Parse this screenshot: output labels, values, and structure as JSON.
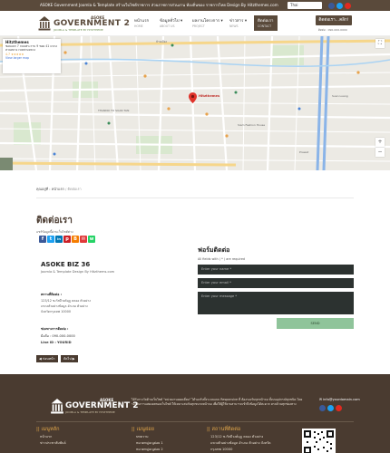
{
  "topbar": {
    "text": "ASOKE Government Joomla & Template  สร้างเว็บไซต์ราชการ ส่วนราชการส่วนงาน ท้องถิ่นของ ราชการไทย Design By Hitzthemes.com",
    "language": "Thai"
  },
  "logo": {
    "top": "ASOKE",
    "main": "GOVERNMENT 2",
    "sub": "JOOMLA & TEMPLATE BY HITZTHEME"
  },
  "nav": [
    {
      "label": "หน้าแรก",
      "sub": "HOME"
    },
    {
      "label": "ข้อมูลทั่วไป ▾",
      "sub": "ABOUT US"
    },
    {
      "label": "ผลงานโครงการ ▾",
      "sub": "PROJECT"
    },
    {
      "label": "ข่าวสาร ▾",
      "sub": "NEWS"
    },
    {
      "label": "ติดต่อเรา",
      "sub": "CONTACT"
    }
  ],
  "header_cta": {
    "label": "ติดต่อเรา...คลิก!",
    "phone": "ติดต่อ : 090-000-0000"
  },
  "map": {
    "place_name": "Hitzthemes",
    "place_address": "ซอยแยก 7 ถนนพระราม 9 ซอย 41 แขวงสวนหลวง เขตสวนหลวง",
    "rating": "4.7 ★★★★★",
    "view_link": "View larger map",
    "labels": [
      "บ้าน หนองบอน",
      "บ้านเมือง",
      "THANNO TO SUAN TAN",
      "Hitzthemes",
      "Siam Fashion House",
      "Suan Luang",
      "Prawet"
    ]
  },
  "breadcrumb": {
    "label": "คุณอยู่ที่ :",
    "home": "หน้าแรก",
    "sep": "/",
    "current": "ติดต่อเรา"
  },
  "page": {
    "title": "ติดต่อเรา",
    "share_label": "แชร์ข้อมูลนี้ผ่านเว็บไซต์ต่าง"
  },
  "share_buttons": [
    {
      "name": "facebook",
      "glyph": "f",
      "color": "#3b5998"
    },
    {
      "name": "twitter",
      "glyph": "t",
      "color": "#1da1f2"
    },
    {
      "name": "linkedin",
      "glyph": "in",
      "color": "#0077b5"
    },
    {
      "name": "pinterest",
      "glyph": "p",
      "color": "#cb2027"
    },
    {
      "name": "blogger",
      "glyph": "B",
      "color": "#f57d00"
    },
    {
      "name": "email",
      "glyph": "✉",
      "color": "#e03a3a"
    },
    {
      "name": "whatsapp",
      "glyph": "w",
      "color": "#25d366"
    }
  ],
  "company": {
    "name": "ASOKE BIZ 36",
    "sub": "Joomla & Template Design By Hitzthems.com",
    "address_heading": "สถานที่ติดต่อ :",
    "address_lines": [
      "123/12 ซ.กัสมีวงค์มุฎ คลอง ตัวอย่าง",
      "แขวงตัวอย่างข้อมูล อำเภอ ตัวอย่าง",
      "จังหวัดกรุงเทพ 10000"
    ],
    "contact_heading": "ช่องทางการติดต่อ :",
    "phone": "มือถือ : 090-000-0000",
    "line": "Line ID : YOURID"
  },
  "form": {
    "title": "ฟอร์มติดต่อ",
    "note": "All fields with ( * ) are required",
    "name_placeholder": "Enter your name *",
    "email_placeholder": "Enter your email *",
    "message_placeholder": "Enter your message *",
    "send_label": "SEND"
  },
  "pager": {
    "prev": "◀ ก่อนหน้า",
    "next": "ถัดไป ▶"
  },
  "footer": {
    "logo_top": "ASOKE",
    "logo_main": "GOVERNMENT 2",
    "logo_sub": "JOOMLA & TEMPLATE BY HITZTHEME",
    "description": "ได้รับรางวัลด้านเว็บไซต์ \"หน่วยงานยอดเยี่ยม\" ได้รองรับทั้งระบบแบบ Responsive ที่ ต้องรองรับทุกหน้าจอ ทั้งบนอุปกรณ์ทุกชนิด โดยรองรับการแสดงผลของเว็บไซต์ ให้เหมาะสมกับทุกขนาดหน้าจอ เพื่อให้ผู้ใช้งานสามารถเข้าถึงข้อมูลได้สะดวก ครบถ้วนทุกช่องทาง",
    "email": "✉ info@yourdomain.com",
    "col1_heading": "|| เมนูหลัก",
    "col1_items": [
      "หน้าแรก",
      "ข่าวประชาสัมพันธ์"
    ],
    "col2_heading": "|| เมนูย่อย",
    "col2_items": [
      "บทความ",
      "หมวดหมู่เมนูย่อย 1",
      "หมวดหมู่เมนูย่อย 2"
    ],
    "col3_heading": "|| สถานที่ติดต่อ",
    "col3_items": [
      "123/12 ซ.กัสมีวงค์มุฎ คลอง ตัวอย่าง",
      "แขวงตัวอย่างข้อมูล อำเภอ ตัวอย่าง จังหวัด",
      "กรุงเทพ 10000"
    ]
  },
  "colors": {
    "brand": "#5a4a3b",
    "accent": "#e0a64a",
    "send": "#8fc49a"
  }
}
